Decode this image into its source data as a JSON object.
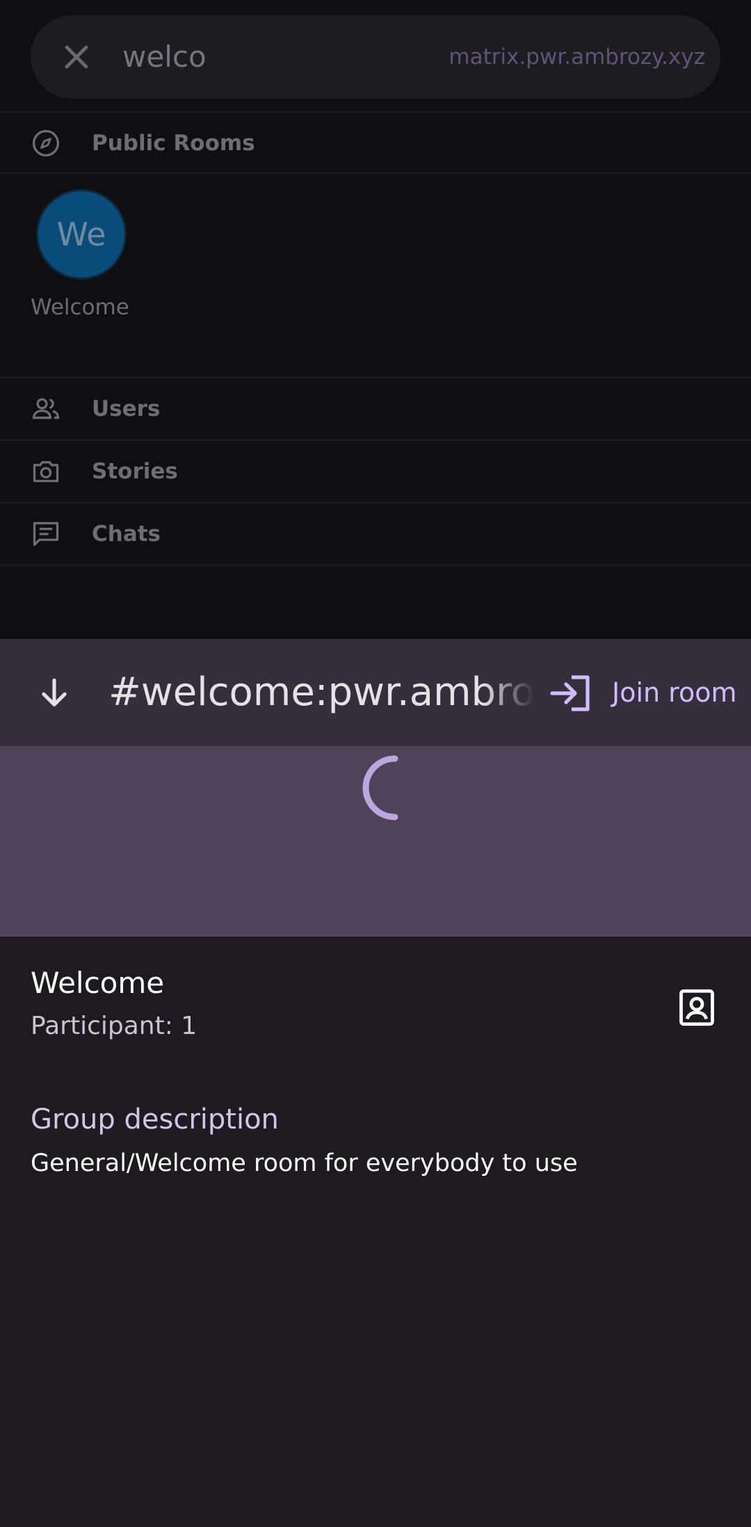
{
  "search": {
    "query": "welco",
    "server": "matrix.pwr.ambrozy.xyz"
  },
  "sections": {
    "public_rooms": "Public Rooms",
    "users": "Users",
    "stories": "Stories",
    "chats": "Chats"
  },
  "public_room": {
    "avatar_initials": "We",
    "name": "Welcome"
  },
  "sheet": {
    "room_alias": "#welcome:pwr.ambrozy.xyz",
    "join_label": "Join room",
    "room_name": "Welcome",
    "participants": "Participant: 1",
    "description_heading": "Group description",
    "description": "General/Welcome room for everybody to use"
  },
  "colors": {
    "accent": "#d0bcff",
    "sheet_bar": "#332f3b",
    "banner": "#4d4459",
    "avatar": "#0a4c79"
  }
}
